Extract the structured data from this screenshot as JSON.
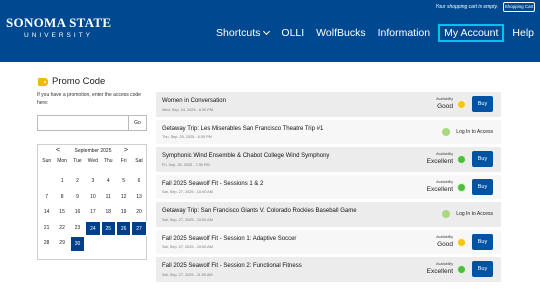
{
  "header": {
    "logo_main": "SONOMA STATE",
    "logo_sub": "UNIVERSITY",
    "cart_message": "Your shopping cart is empty.",
    "cart_button": "Shopping Cart",
    "nav": [
      "Shortcuts",
      "OLLI",
      "WolfBucks",
      "Information",
      "My Account",
      "Help"
    ],
    "active_nav": "My Account",
    "color_brand": "#004990",
    "color_active_border": "#00c2f0"
  },
  "promo": {
    "title": "Promo Code",
    "help": "If you have a promotion, enter the access code here:",
    "input_value": "",
    "go_label": "Go",
    "icon": "tag-icon"
  },
  "calendar": {
    "month_label": "September 2025",
    "prev": "<",
    "next": ">",
    "weekdays": [
      "Sun",
      "Mon",
      "Tue",
      "Wed",
      "Thu",
      "Fri",
      "Sat"
    ],
    "days": [
      "",
      "1",
      "2",
      "3",
      "4",
      "5",
      "6",
      "7",
      "8",
      "9",
      "10",
      "11",
      "12",
      "13",
      "14",
      "15",
      "16",
      "17",
      "18",
      "19",
      "20",
      "21",
      "22",
      "23",
      "24",
      "25",
      "26",
      "27",
      "28",
      "29",
      "30",
      "",
      "",
      "",
      ""
    ],
    "selected_days": [
      "24",
      "25",
      "26",
      "27",
      "30"
    ]
  },
  "events": [
    {
      "title": "Women in Conversation",
      "date": "Wed, Sep. 24, 2025 - 6:30 PM",
      "availability_label": "Availability",
      "availability": "Good",
      "status": "yellow",
      "action": "Buy"
    },
    {
      "title": "Getaway Trip: Les Miserables San Francisco Theatre Trip #1",
      "date": "Thu, Sep. 25, 2025 - 6:30 PM",
      "availability_label": "",
      "availability": "",
      "status": "login",
      "action": "Log In to Access"
    },
    {
      "title": "Symphonic Wind Ensemble & Chabot College Wind Symphony",
      "date": "Fri, Sep. 26, 2025 - 7:30 PM",
      "availability_label": "Availability",
      "availability": "Excellent",
      "status": "green",
      "action": "Buy"
    },
    {
      "title": "Fall 2025 Seawolf Fit - Sessions 1 & 2",
      "date": "Sat, Sep. 27, 2025 - 10:00 AM",
      "availability_label": "Availability",
      "availability": "Excellent",
      "status": "green",
      "action": "Buy"
    },
    {
      "title": "Getaway Trip: San Francisco Giants V. Colorado Rockies Baseball Game",
      "date": "Sat, Sep. 27, 2025 - 10:00 AM",
      "availability_label": "",
      "availability": "",
      "status": "login",
      "action": "Log In to Access"
    },
    {
      "title": "Fall 2025 Seawolf Fit - Session 1: Adaptive Soccer",
      "date": "Sat, Sep. 27, 2025 - 10:00 AM",
      "availability_label": "Availability",
      "availability": "Good",
      "status": "yellow",
      "action": "Buy"
    },
    {
      "title": "Fall 2025 Seawolf Fit - Session 2: Functional Fitness",
      "date": "Sat, Sep. 27, 2025 - 11:00 AM",
      "availability_label": "Availability",
      "availability": "Excellent",
      "status": "green",
      "action": "Buy"
    }
  ]
}
